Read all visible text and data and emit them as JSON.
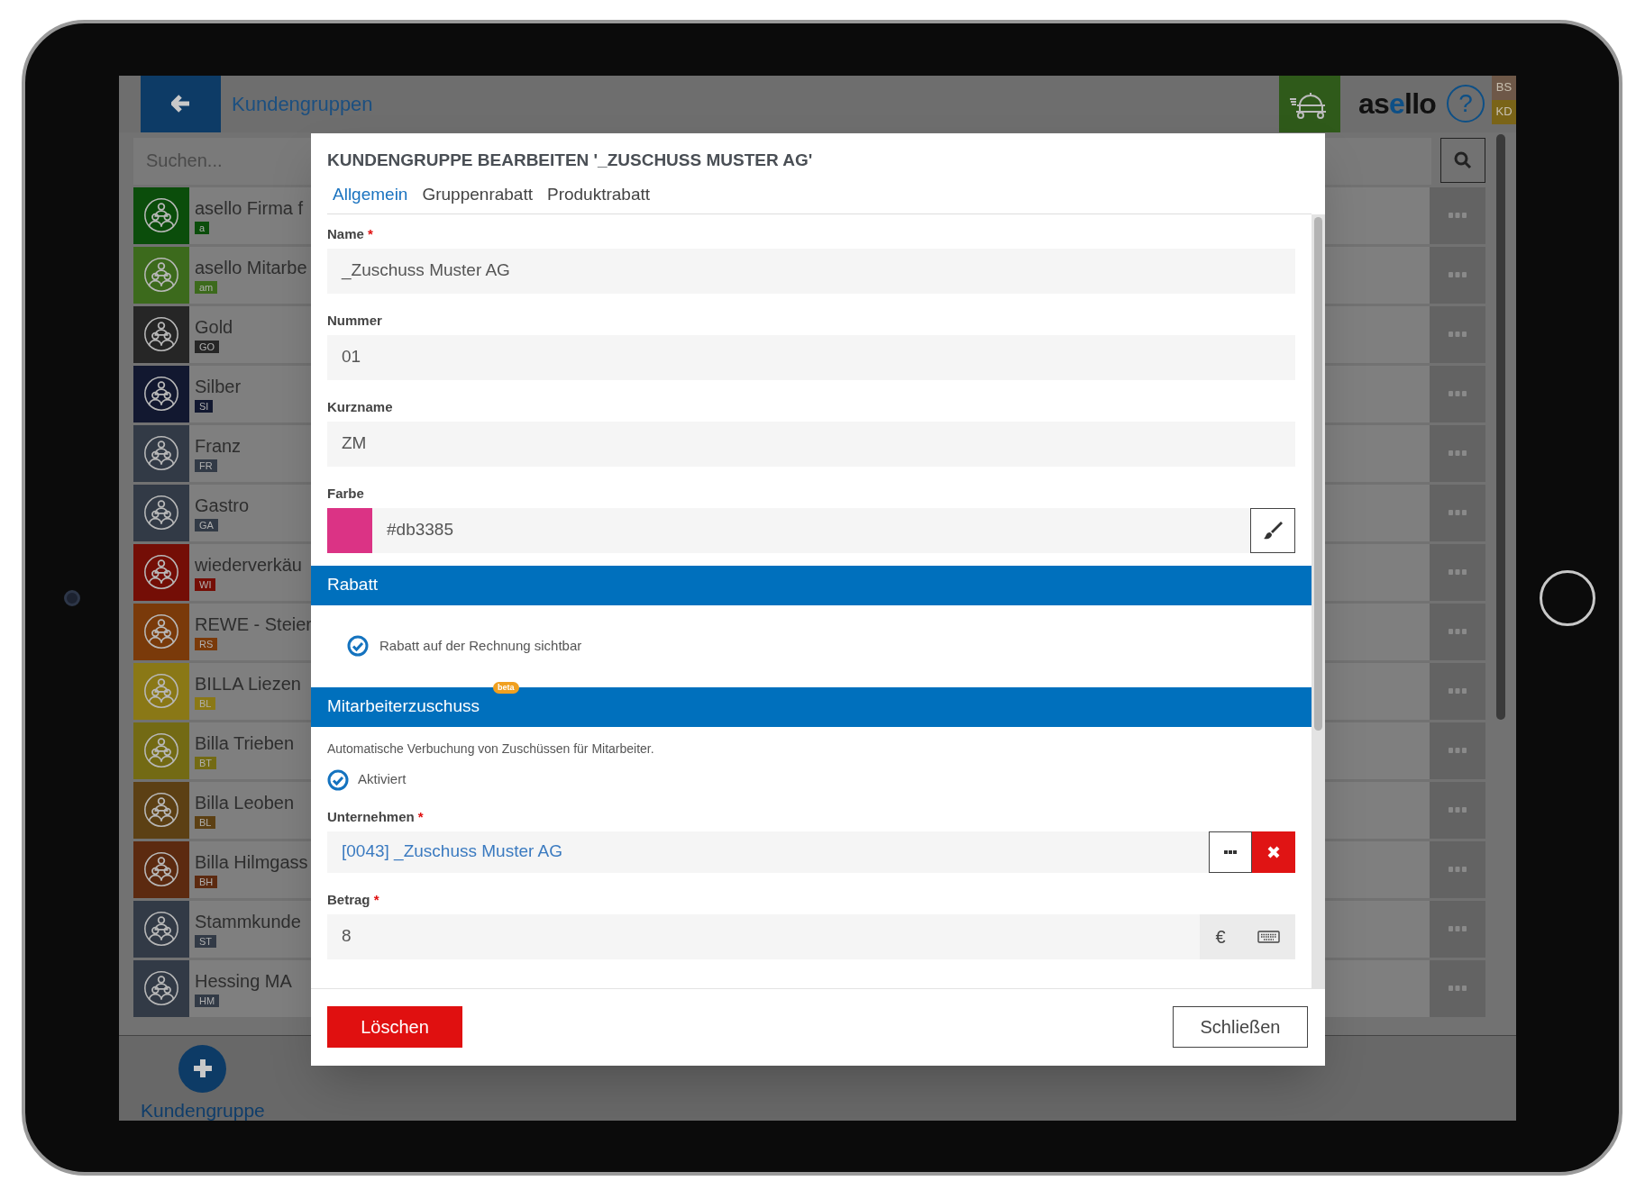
{
  "topbar": {
    "title": "Kundengruppen",
    "logo": [
      {
        "text": "as",
        "accent": false
      },
      {
        "text": "e",
        "accent": true
      },
      {
        "text": "llo",
        "accent": false
      }
    ],
    "help": "?",
    "badges": [
      {
        "label": "BS",
        "color": "#6e5848"
      },
      {
        "label": "KD",
        "color": "#7a6418"
      }
    ]
  },
  "search": {
    "placeholder": "Suchen..."
  },
  "groups": [
    {
      "name": "asello Firma f",
      "code": "a",
      "color": "#0b4d0b"
    },
    {
      "name": "asello Mitarbe",
      "code": "am",
      "color": "#3c6a1c"
    },
    {
      "name": "Gold",
      "code": "GO",
      "color": "#262626"
    },
    {
      "name": "Silber",
      "code": "SI",
      "color": "#121830"
    },
    {
      "name": "Franz",
      "code": "FR",
      "color": "#323a46"
    },
    {
      "name": "Gastro",
      "code": "GA",
      "color": "#323a46"
    },
    {
      "name": "wiederverkäu",
      "code": "WI",
      "color": "#740e06"
    },
    {
      "name": "REWE - Steier",
      "code": "RS",
      "color": "#7a3a0a"
    },
    {
      "name": "BILLA Liezen",
      "code": "BL",
      "color": "#8a7816"
    },
    {
      "name": "Billa Trieben",
      "code": "BT",
      "color": "#736a14"
    },
    {
      "name": "Billa Leoben",
      "code": "BL",
      "color": "#5c4014"
    },
    {
      "name": "Billa Hilmgass",
      "code": "BH",
      "color": "#5c2a10"
    },
    {
      "name": "Stammkunde",
      "code": "ST",
      "color": "#323a46"
    },
    {
      "name": "Hessing MA",
      "code": "HM",
      "color": "#323a46"
    }
  ],
  "add_button": {
    "label": "Kundengruppe"
  },
  "dialog": {
    "title": "KUNDENGRUPPE BEARBEITEN '_ZUSCHUSS MUSTER AG'",
    "tabs": [
      {
        "label": "Allgemein",
        "selected": true
      },
      {
        "label": "Gruppenrabatt",
        "selected": false
      },
      {
        "label": "Produktrabatt",
        "selected": false
      }
    ],
    "items": [
      {
        "kind": "text",
        "label": "Name",
        "required_mark": "*",
        "value": "_Zuschuss Muster AG"
      },
      {
        "kind": "text",
        "label": "Nummer",
        "value": "01"
      },
      {
        "kind": "text",
        "label": "Kurzname",
        "value": "ZM"
      },
      {
        "kind": "color",
        "label": "Farbe",
        "value": "#db3385",
        "color": "#db3385"
      },
      {
        "kind": "section",
        "title": "Rabatt"
      },
      {
        "kind": "indented_checkbox",
        "label": "Rabatt auf der Rechnung sichtbar",
        "checked": true
      },
      {
        "kind": "section",
        "title": "Mitarbeiterzuschuss",
        "badge": "beta"
      },
      {
        "kind": "note",
        "text": "Automatische Verbuchung von Zuschüssen für Mitarbeiter."
      },
      {
        "kind": "checkbox",
        "label": "Aktiviert",
        "checked": true
      },
      {
        "kind": "picker",
        "label": "Unternehmen",
        "required_mark": "*",
        "value": "[0043] _Zuschuss Muster AG"
      },
      {
        "kind": "amount",
        "label": "Betrag",
        "required_mark": "*",
        "value": "8",
        "unit": "€"
      }
    ],
    "buttons": [
      {
        "label": "Löschen",
        "kind": "danger"
      },
      {
        "label": "Schließen",
        "kind": "outline"
      }
    ]
  }
}
